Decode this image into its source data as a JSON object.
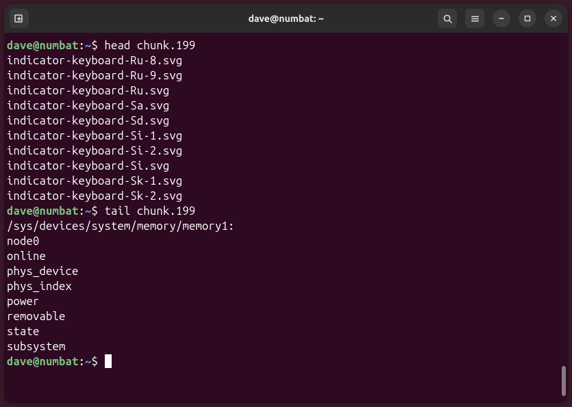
{
  "titlebar": {
    "title": "dave@numbat: ~"
  },
  "prompt": {
    "user_host": "dave@numbat",
    "path": "~",
    "symbol": "$"
  },
  "commands": {
    "cmd1": " head chunk.199",
    "cmd2": " tail chunk.199"
  },
  "output1": [
    "indicator-keyboard-Ru-8.svg",
    "indicator-keyboard-Ru-9.svg",
    "indicator-keyboard-Ru.svg",
    "indicator-keyboard-Sa.svg",
    "indicator-keyboard-Sd.svg",
    "indicator-keyboard-Si-1.svg",
    "indicator-keyboard-Si-2.svg",
    "indicator-keyboard-Si.svg",
    "indicator-keyboard-Sk-1.svg",
    "indicator-keyboard-Sk-2.svg"
  ],
  "output2": [
    "",
    "/sys/devices/system/memory/memory1:",
    "node0",
    "online",
    "phys_device",
    "phys_index",
    "power",
    "removable",
    "state",
    "subsystem"
  ]
}
